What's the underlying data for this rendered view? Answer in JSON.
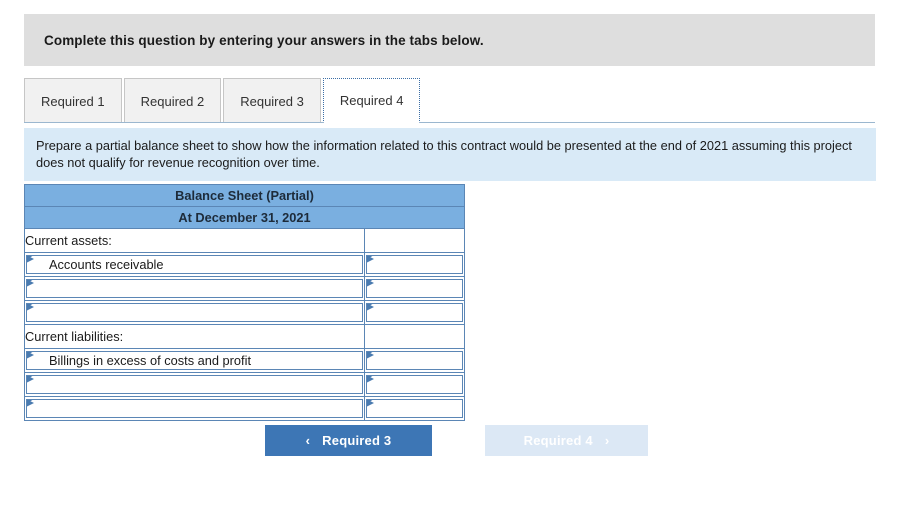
{
  "banner": {
    "text": "Complete this question by entering your answers in the tabs below."
  },
  "tabs": [
    {
      "label": "Required 1",
      "active": false
    },
    {
      "label": "Required 2",
      "active": false
    },
    {
      "label": "Required 3",
      "active": false
    },
    {
      "label": "Required 4",
      "active": true
    }
  ],
  "instruction": {
    "text": "Prepare a partial balance sheet to show how the information related to this contract would be presented at the end of 2021 assuming this project does not qualify for revenue recognition over time."
  },
  "balance_sheet": {
    "title": "Balance Sheet (Partial)",
    "subtitle": "At December 31, 2021",
    "rows": [
      {
        "type": "static",
        "label": "Current assets:",
        "amount": ""
      },
      {
        "type": "input",
        "label": "Accounts receivable",
        "amount": ""
      },
      {
        "type": "input",
        "label": "",
        "amount": ""
      },
      {
        "type": "input",
        "label": "",
        "amount": ""
      },
      {
        "type": "static",
        "label": "Current liabilities:",
        "amount": ""
      },
      {
        "type": "input",
        "label": "Billings in excess of costs and profit",
        "amount": ""
      },
      {
        "type": "input",
        "label": "",
        "amount": ""
      },
      {
        "type": "input",
        "label": "",
        "amount": ""
      }
    ]
  },
  "nav": {
    "prev_label": "Required 3",
    "prev_chevron": "‹",
    "next_label": "Required 4",
    "next_chevron": "›"
  },
  "colors": {
    "banner_gray": "#dedede",
    "instruction_blue": "#d9eaf7",
    "table_header_blue": "#7aafe0",
    "table_border_blue": "#5b86b5",
    "button_active": "#3d76b5",
    "button_disabled": "#dce8f5"
  }
}
